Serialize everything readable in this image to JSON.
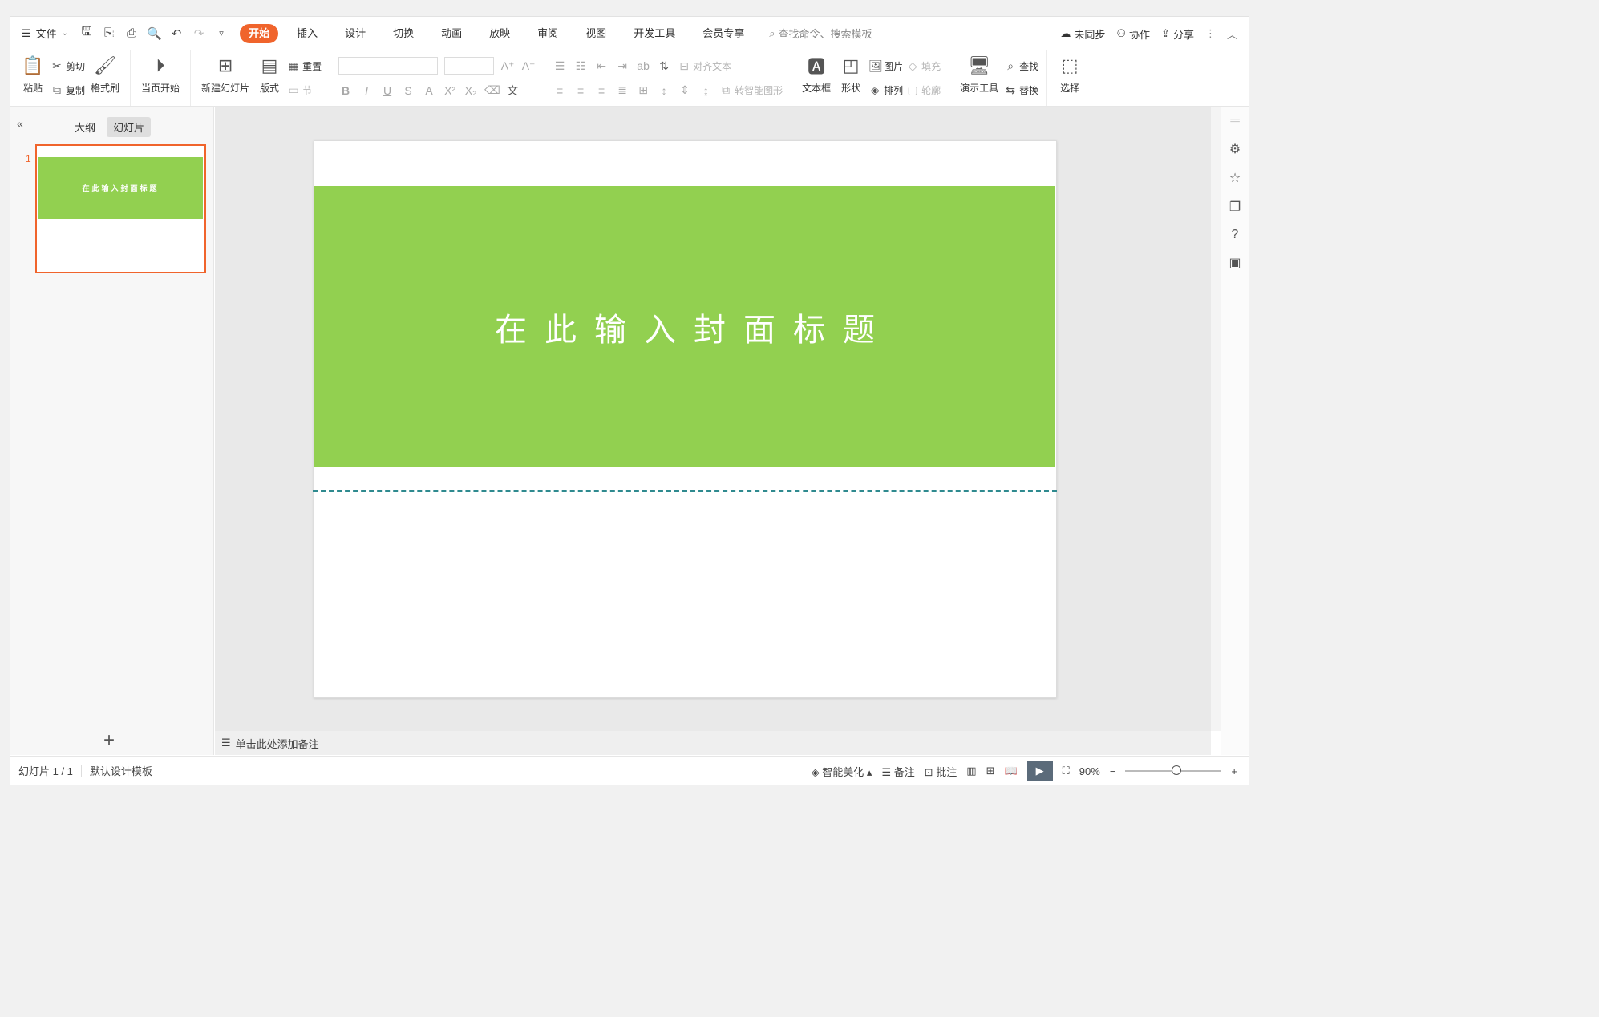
{
  "menubar": {
    "file_label": "文件",
    "tabs": [
      "开始",
      "插入",
      "设计",
      "切换",
      "动画",
      "放映",
      "审阅",
      "视图",
      "开发工具",
      "会员专享"
    ],
    "search_placeholder": "查找命令、搜索模板",
    "sync_label": "未同步",
    "collab_label": "协作",
    "share_label": "分享"
  },
  "ribbon": {
    "paste": "粘贴",
    "cut": "剪切",
    "copy": "复制",
    "format_painter": "格式刷",
    "from_current": "当页开始",
    "new_slide": "新建幻灯片",
    "layout": "版式",
    "reset": "重置",
    "section": "节",
    "align_text": "对齐文本",
    "smartart": "转智能图形",
    "textbox": "文本框",
    "shape": "形状",
    "picture": "图片",
    "fill": "填充",
    "arrange": "排列",
    "outline": "轮廓",
    "presentation_tools": "演示工具",
    "find": "查找",
    "replace": "替换",
    "select": "选择"
  },
  "leftpanel": {
    "tab_outline": "大纲",
    "tab_slides": "幻灯片",
    "slide_number": "1",
    "thumb_title": "在此输入封面标题"
  },
  "slide": {
    "title": "在此输入封面标题",
    "band_color": "#92d050",
    "dash_color": "#2f8a8f"
  },
  "notes": {
    "placeholder": "单击此处添加备注"
  },
  "status": {
    "slide_indicator": "幻灯片 1 / 1",
    "template": "默认设计模板",
    "beautify": "智能美化",
    "notes": "备注",
    "comments": "批注",
    "zoom": "90%"
  },
  "colors": {
    "accent": "#f0642c"
  }
}
